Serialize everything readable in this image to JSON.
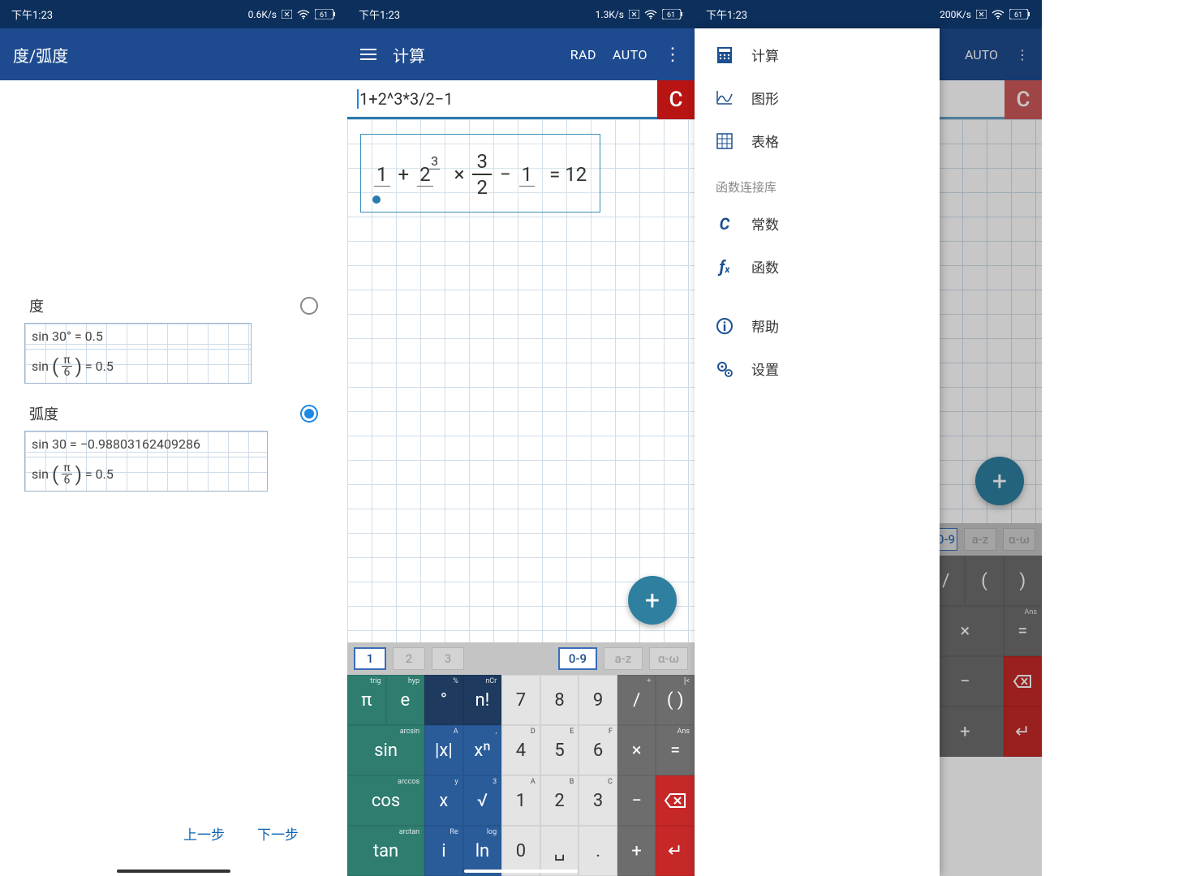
{
  "statusbar": {
    "time": "下午1:23",
    "speeds": [
      "0.6K/s",
      "1.3K/s",
      "200K/s"
    ],
    "battery": "61"
  },
  "s1": {
    "title": "度/弧度",
    "opt1": {
      "label": "度",
      "ex1_a": "sin 30°",
      "ex1_b": "= 0.5",
      "ex2_a": "sin",
      "ex2_b": "= 0.5"
    },
    "opt2": {
      "label": "弧度",
      "ex1_a": "sin 30 =",
      "ex1_b": "−0.98803162409286",
      "ex2_a": "sin",
      "ex2_b": "= 0.5"
    },
    "pi_num": "π",
    "pi_den": "6",
    "prev": "上一步",
    "next": "下一步"
  },
  "s2": {
    "title": "计算",
    "rad": "RAD",
    "auto": "AUTO",
    "input": "1+2^3*3/2−1",
    "clear": "C",
    "result_eq": "= 12",
    "tabs": {
      "t1": "1",
      "t2": "2",
      "t3": "3",
      "t4": "0-9",
      "t5": "a-z",
      "t6": "α-ω"
    },
    "keys": {
      "r1": [
        {
          "m": "π",
          "s": "trig"
        },
        {
          "m": "e",
          "s": "hyp"
        },
        {
          "m": "°",
          "s": "%"
        },
        {
          "m": "n!",
          "s": "nCr"
        },
        {
          "m": "7",
          "s": ""
        },
        {
          "m": "8",
          "s": ""
        },
        {
          "m": "9",
          "s": ""
        },
        {
          "m": "/",
          "s": "÷"
        },
        {
          "m": "( )",
          "s": "[<"
        }
      ],
      "r2": [
        {
          "m": "sin",
          "s": "arcsin"
        },
        {
          "m": "|x|",
          "s": "A"
        },
        {
          "m": "xⁿ",
          "s": ","
        },
        {
          "m": "4",
          "s": "D"
        },
        {
          "m": "5",
          "s": "E"
        },
        {
          "m": "6",
          "s": "F"
        },
        {
          "m": "×",
          "s": ""
        },
        {
          "m": "=",
          "s": "Ans"
        }
      ],
      "r3": [
        {
          "m": "cos",
          "s": "arccos"
        },
        {
          "m": "x",
          "s": "y"
        },
        {
          "m": "√",
          "s": "3"
        },
        {
          "m": "1",
          "s": "A"
        },
        {
          "m": "2",
          "s": "B"
        },
        {
          "m": "3",
          "s": "C"
        },
        {
          "m": "−",
          "s": ""
        },
        {
          "m": "⌫",
          "s": ""
        }
      ],
      "r4": [
        {
          "m": "tan",
          "s": "arctan"
        },
        {
          "m": "i",
          "s": "Re"
        },
        {
          "m": "ln",
          "s": "log"
        },
        {
          "m": "0",
          "s": ""
        },
        {
          "m": "␣",
          "s": ""
        },
        {
          "m": ".",
          "s": ""
        },
        {
          "m": "+",
          "s": ""
        },
        {
          "m": "↵",
          "s": ""
        }
      ]
    }
  },
  "s3": {
    "menu": {
      "calc": "计算",
      "graph": "图形",
      "table": "表格",
      "hdr": "函数连接库",
      "const": "常数",
      "func": "函数",
      "help": "帮助",
      "settings": "设置"
    },
    "auto": "AUTO"
  }
}
